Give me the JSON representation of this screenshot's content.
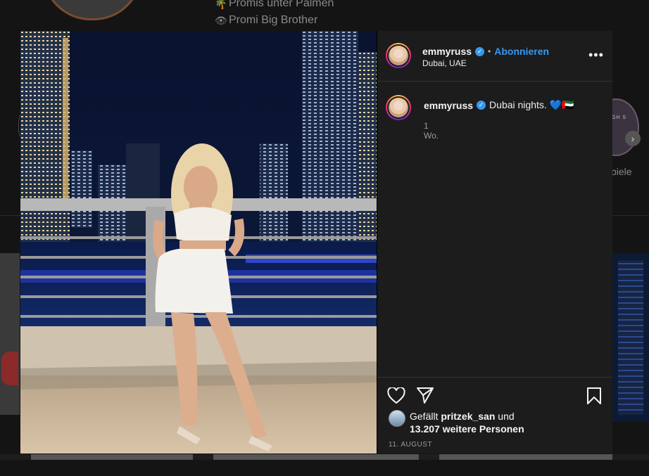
{
  "background": {
    "list_items": [
      {
        "icon": "palm-tree-icon",
        "glyph": "🌴",
        "label": "Promis unter Palmen"
      },
      {
        "icon": "eye-icon",
        "glyph": "👁",
        "label": "Promi Big Brother"
      }
    ],
    "highlight_circle_text": "NIGH S",
    "side_label": "piele",
    "next_arrow": "›"
  },
  "post": {
    "author": {
      "username": "emmyruss",
      "verified_glyph": "✓",
      "follow_label": "Abonnieren",
      "separator": "•",
      "location": "Dubai, UAE"
    },
    "more_glyph": "•••",
    "caption": {
      "username": "emmyruss",
      "text": "Dubai nights. 💙🇦🇪",
      "time_ago": "1 Wo."
    },
    "likes": {
      "prefix": "Gefällt",
      "liker": "pritzek_san",
      "middle": "und",
      "others": "13.207 weitere Personen"
    },
    "date": "11. AUGUST"
  },
  "colors": {
    "accent": "#3897f0",
    "sidebar_bg": "#1c1c1d",
    "page_bg": "#121212"
  }
}
